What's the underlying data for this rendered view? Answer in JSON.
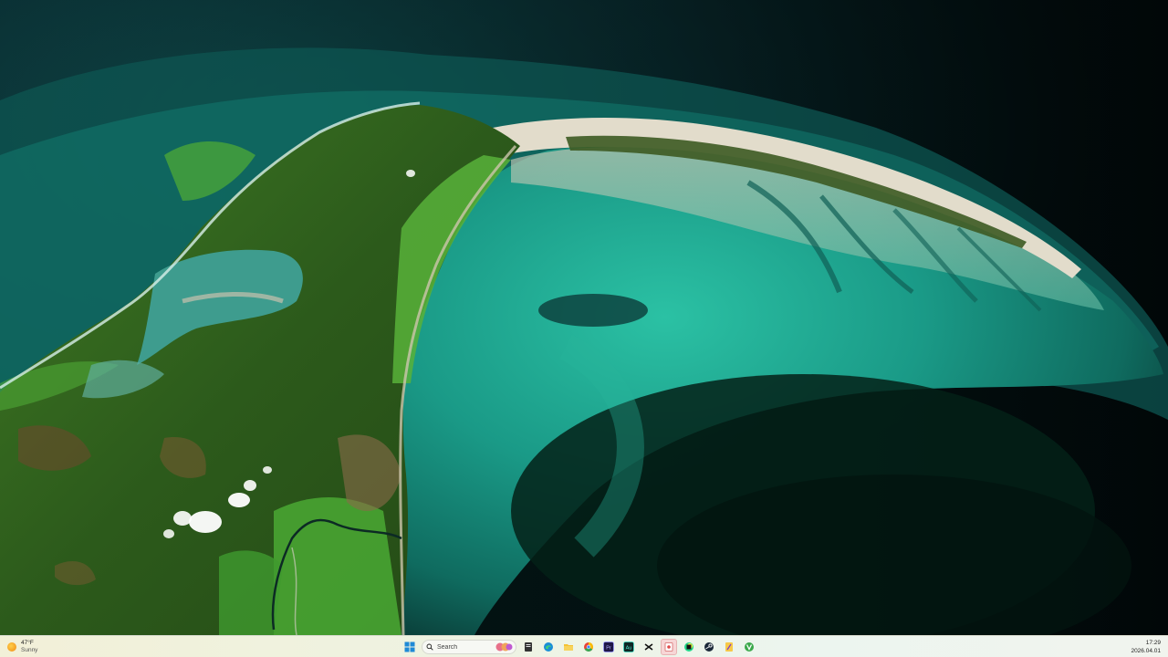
{
  "wallpaper": {
    "description_icon": "satellite-coastline-wallpaper"
  },
  "taskbar": {
    "weather": {
      "temperature": "47°F",
      "condition": "Sunny",
      "icon": "sun-icon"
    },
    "search": {
      "placeholder": "Search"
    },
    "apps": [
      {
        "name": "start-button",
        "icon": "windows-logo-icon"
      },
      {
        "name": "file-manager",
        "icon": "files-icon"
      },
      {
        "name": "edge",
        "icon": "edge-icon"
      },
      {
        "name": "file-explorer",
        "icon": "folder-icon"
      },
      {
        "name": "chrome",
        "icon": "chrome-icon"
      },
      {
        "name": "premiere-pro",
        "icon": "premiere-icon",
        "label": "Pr"
      },
      {
        "name": "audition",
        "icon": "audition-icon",
        "label": "Au"
      },
      {
        "name": "capcut",
        "icon": "capcut-icon"
      },
      {
        "name": "app-active",
        "icon": "app-icon"
      },
      {
        "name": "pycharm",
        "icon": "pycharm-icon"
      },
      {
        "name": "steam",
        "icon": "steam-icon"
      },
      {
        "name": "notes-app",
        "icon": "notes-icon"
      },
      {
        "name": "vivaldi",
        "icon": "vivaldi-icon"
      }
    ],
    "clock": {
      "time": "17:29",
      "date": "2026.04.01"
    }
  },
  "colors": {
    "taskbar_bg": "#eef3e2",
    "sea_deep": "#03171a",
    "lagoon": "#1fa88f",
    "forest": "#2f5a1e",
    "sand": "#d8d2c0"
  }
}
